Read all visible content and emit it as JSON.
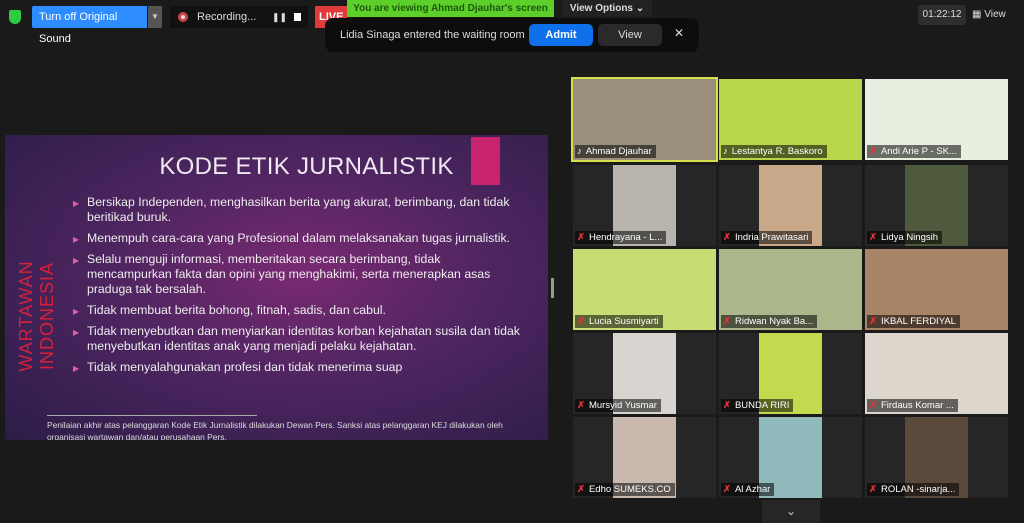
{
  "toolbar": {
    "sound_button": "Turn off Original Sound",
    "recording": "Recording...",
    "pause_glyph": "❚❚",
    "live": "LIVE",
    "banner": "You are viewing Ahmad Djauhar's screen",
    "view_options": "View Options ⌄",
    "timer": "01:22:12",
    "view": "View"
  },
  "notification": {
    "message": "Lidia Sinaga entered the waiting room",
    "admit": "Admit",
    "view": "View",
    "close": "✕"
  },
  "slide": {
    "title": "KODE ETIK JURNALISTIK",
    "side_text": "WARTAWAN INDONESIA",
    "bullets": [
      "Bersikap Independen, menghasilkan berita yang akurat, berimbang, dan tidak beritikad buruk.",
      "Menempuh cara-cara yang Profesional dalam melaksanakan tugas jurnalistik.",
      "Selalu menguji informasi, memberitakan secara berimbang, tidak mencampurkan fakta dan opini yang menghakimi, serta menerapkan asas praduga tak bersalah.",
      "Tidak membuat berita bohong, fitnah, sadis, dan cabul.",
      "Tidak menyebutkan dan menyiarkan identitas korban kejahatan susila dan tidak menyebutkan identitas anak yang menjadi pelaku kejahatan.",
      "Tidak menyalahgunakan profesi dan tidak menerima suap"
    ],
    "note": "Penilaian akhir atas pelanggaran Kode Etik Jurnalistik dilakukan Dewan Pers. Sanksi atas pelanggaran KEJ dilakukan oleh organisasi wartawan dan/atau perusahaan Pers."
  },
  "participants": [
    {
      "name": "Ahmad Djauhar",
      "muted": false,
      "active": true,
      "color": "#9a8f7c"
    },
    {
      "name": "Lestantya R. Baskoro",
      "muted": false,
      "color": "#b7d64a"
    },
    {
      "name": "Andi Arie P - SK...",
      "muted": true,
      "color": "#e8efe0"
    },
    {
      "name": "Hendrayana - L...",
      "muted": true,
      "color": "#b9b4ad"
    },
    {
      "name": "Indria Prawitasari",
      "muted": true,
      "color": "#c9a989"
    },
    {
      "name": "Lidya Ningsih",
      "muted": true,
      "color": "#4f5a3c"
    },
    {
      "name": "Lucia Susmiyarti",
      "muted": true,
      "color": "#c7dd74"
    },
    {
      "name": "Ridwan Nyak Ba...",
      "muted": true,
      "color": "#a9b78a"
    },
    {
      "name": "IKBAL FERDIYAL",
      "muted": true,
      "color": "#a88466"
    },
    {
      "name": "Mursyid Yusmar",
      "muted": true,
      "color": "#d8d4cf"
    },
    {
      "name": "BUNDA RIRI",
      "muted": true,
      "color": "#c3d94e"
    },
    {
      "name": "Firdaus Komar ...",
      "muted": true,
      "color": "#ddd6cc"
    },
    {
      "name": "Edho SUMEKS.CO",
      "muted": true,
      "color": "#c8b8ad"
    },
    {
      "name": "Al Azhar",
      "muted": true,
      "color": "#8fb9bb"
    },
    {
      "name": "ROLAN -sinarja...",
      "muted": true,
      "color": "#5a4a3c"
    }
  ],
  "colors": {
    "accent": "#2d8cff",
    "banner": "#5ccf2a",
    "live": "#e03b3b",
    "active_outline": "#d6e04a"
  }
}
